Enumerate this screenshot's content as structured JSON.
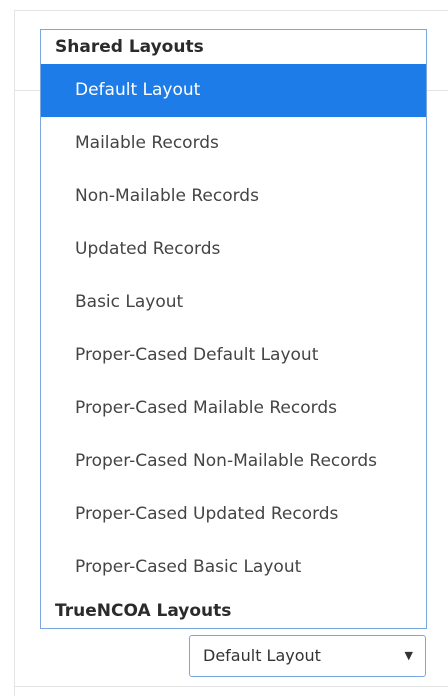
{
  "dropdown": {
    "groups": [
      {
        "label": "Shared Layouts",
        "options": [
          "Default Layout",
          "Mailable Records",
          "Non-Mailable Records",
          "Updated Records",
          "Basic Layout",
          "Proper-Cased Default Layout",
          "Proper-Cased Mailable Records",
          "Proper-Cased Non-Mailable Records",
          "Proper-Cased Updated Records",
          "Proper-Cased Basic Layout"
        ]
      },
      {
        "label": "TrueNCOA Layouts",
        "options": []
      }
    ],
    "highlighted": "Default Layout"
  },
  "select": {
    "value": "Default Layout",
    "arrow_icon": "chevron-down-icon"
  },
  "colors": {
    "highlight": "#1e7ce8",
    "border": "#7aa7e0"
  }
}
